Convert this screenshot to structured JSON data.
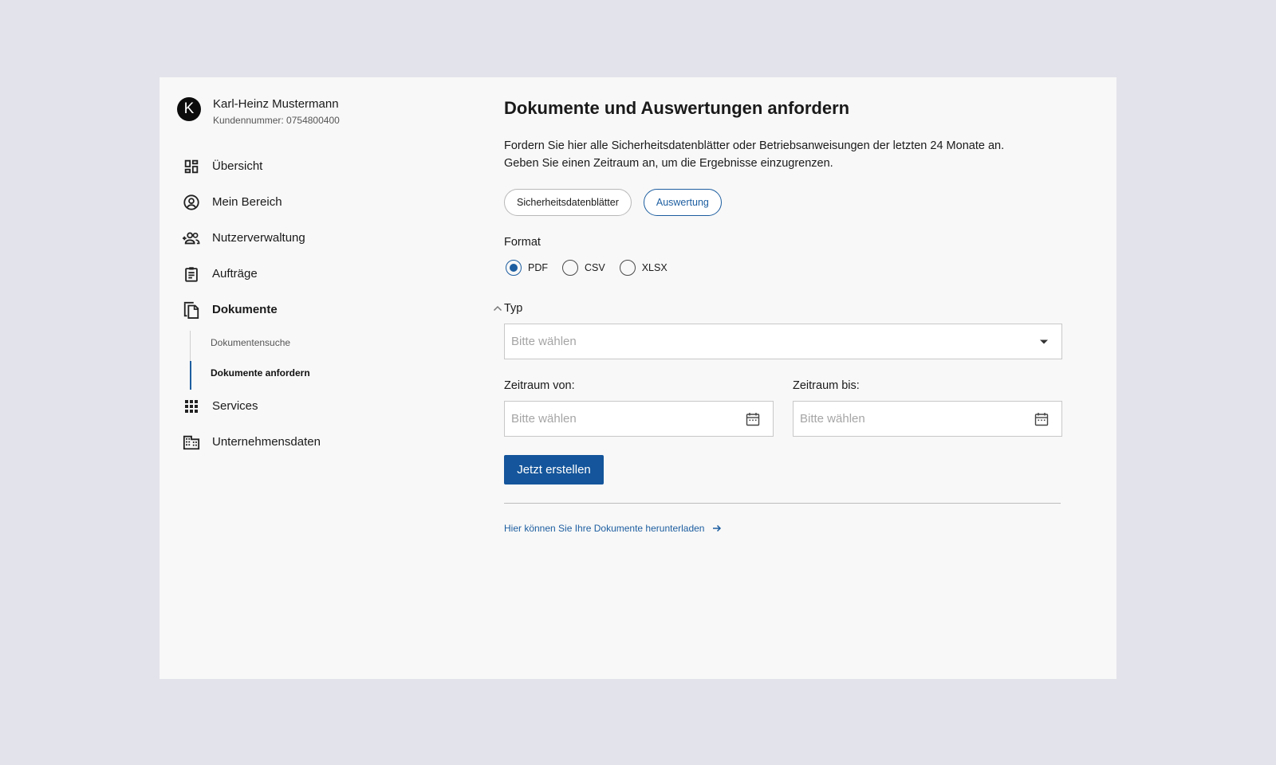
{
  "user": {
    "avatar_letter": "K",
    "name": "Karl-Heinz Mustermann",
    "customer_number": "Kundennummer: 0754800400"
  },
  "nav": {
    "items": [
      {
        "label": "Übersicht",
        "icon": "dashboard-icon"
      },
      {
        "label": "Mein Bereich",
        "icon": "account-circle-icon"
      },
      {
        "label": "Nutzerverwaltung",
        "icon": "group-add-icon"
      },
      {
        "label": "Aufträge",
        "icon": "clipboard-icon"
      },
      {
        "label": "Dokumente",
        "icon": "documents-icon",
        "expanded": true
      },
      {
        "label": "Services",
        "icon": "apps-grid-icon"
      },
      {
        "label": "Unternehmensdaten",
        "icon": "building-icon"
      }
    ],
    "sub_items": [
      {
        "label": "Dokumentensuche",
        "active": false
      },
      {
        "label": "Dokumente anfordern",
        "active": true
      }
    ]
  },
  "main": {
    "title": "Dokumente und Auswertungen anfordern",
    "description_line1": "Fordern Sie hier alle Sicherheitsdatenblätter oder Betriebsanweisungen der letzten 24 Monate an.",
    "description_line2": "Geben Sie einen Zeitraum an, um die Ergebnisse einzugrenzen.",
    "chips": [
      {
        "label": "Sicherheitsdatenblätter",
        "selected": false
      },
      {
        "label": "Auswertung",
        "selected": true
      }
    ],
    "format_label": "Format",
    "formats": [
      {
        "label": "PDF",
        "checked": true
      },
      {
        "label": "CSV",
        "checked": false
      },
      {
        "label": "XLSX",
        "checked": false
      }
    ],
    "typ_label": "Typ",
    "typ_placeholder": "Bitte wählen",
    "date_from_label": "Zeitraum von:",
    "date_from_placeholder": "Bitte wählen",
    "date_to_label": "Zeitraum bis:",
    "date_to_placeholder": "Bitte wählen",
    "submit_label": "Jetzt erstellen",
    "download_link": "Hier können Sie Ihre Dokumente herunterladen"
  },
  "colors": {
    "primary": "#14559b",
    "accent_text": "#1d5ea0",
    "page_background": "#e2e3eb",
    "card_background": "#f8f8f8"
  }
}
